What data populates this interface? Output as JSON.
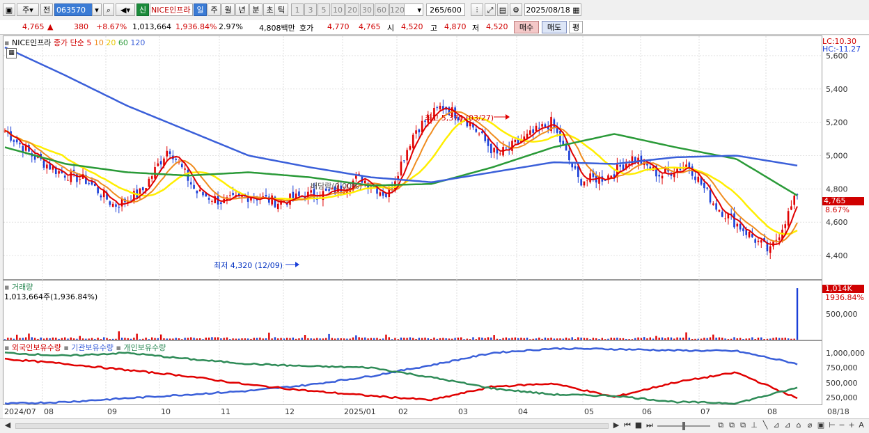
{
  "toolbar": {
    "market_label": "주",
    "prev_label": "전",
    "code_value": "063570",
    "signal_label": "신",
    "stock_name": "NICE인프라",
    "period_tabs": [
      "일",
      "주",
      "월",
      "년",
      "분",
      "초",
      "틱"
    ],
    "period_active": "일",
    "minute_options": [
      "1",
      "3",
      "5",
      "10",
      "20",
      "30",
      "60",
      "120"
    ],
    "count_value": "265",
    "count_max": "/600",
    "date_value": "2025/08/18"
  },
  "quote": {
    "price": "4,765",
    "arrow": "▲",
    "change": "380",
    "change_pct": "+8.67%",
    "volume": "1,013,664",
    "volume_ratio": "1,936.84%",
    "turnover_pct": "2.97%",
    "amount": "4,808백만",
    "hoga_label": "호가",
    "ask": "4,770",
    "bid": "4,765",
    "open_label": "시",
    "open": "4,520",
    "high_label": "고",
    "high": "4,870",
    "low_label": "저",
    "low": "4,520",
    "buy_label": "매수",
    "sell_label": "매도",
    "eval_label": "평"
  },
  "price_panel": {
    "legend_name": "NICE인프라",
    "legend_type": "종가 단순",
    "ma_labels": [
      "5",
      "10",
      "20",
      "60",
      "120"
    ],
    "lc": "LC:10.30",
    "hc": "HC:-11.27",
    "high_annotation": "최고 5,370 (03/27)",
    "low_annotation": "최저 4,320 (12/09)",
    "dividend_annotation": "배당락(0.00%)",
    "last_price_label": "4,765",
    "last_pct_label": "8.67%",
    "y_ticks": [
      "5,600",
      "5,400",
      "5,200",
      "5,000",
      "4,800",
      "4,600",
      "4,400"
    ]
  },
  "volume_panel": {
    "title": "거래량",
    "summary": "1,013,664주(1,936.84%)",
    "last_label": "1,014K",
    "last_pct": "1936.84%",
    "y_ticks": [
      "500,000"
    ]
  },
  "holding_panel": {
    "legend": [
      "외국인보유수량",
      "기관보유수량",
      "개인보유수량"
    ],
    "y_ticks": [
      "1,000,000",
      "750,000",
      "500,000",
      "250,000"
    ]
  },
  "x_ticks": [
    "2024/07",
    "08",
    "09",
    "10",
    "11",
    "12",
    "2025/01",
    "02",
    "03",
    "04",
    "05",
    "06",
    "07",
    "08",
    "08/18"
  ],
  "colors": {
    "candle_up": "#e00000",
    "candle_down": "#1a3fd8",
    "ma5": "#e00000",
    "ma10": "#f08c1e",
    "ma20": "#ffee00",
    "ma60": "#2a9a38",
    "ma120": "#3a5fd9",
    "foreign": "#3a5fd9",
    "institution": "#e00000",
    "individual": "#2e8b57"
  },
  "chart_data": {
    "type": "candlestick",
    "title": "NICE인프라",
    "x_range": [
      "2024/07",
      "2025/08/18"
    ],
    "price_ylim": [
      4300,
      5700
    ],
    "key_points": [
      {
        "label": "최고",
        "value": 5370,
        "date": "03/27"
      },
      {
        "label": "최저",
        "value": 4320,
        "date": "12/09"
      },
      {
        "label": "last close",
        "value": 4765,
        "date": "08/18"
      }
    ],
    "ma120_approx": [
      5650,
      5480,
      5300,
      5150,
      5000,
      4930,
      4870,
      4840,
      4900,
      4960,
      4950,
      4990,
      5000,
      4940
    ],
    "ma60_approx": [
      5050,
      4950,
      4900,
      4880,
      4900,
      4870,
      4820,
      4830,
      4930,
      5050,
      5130,
      5050,
      4980,
      4760
    ],
    "volume_last": 1013664,
    "holdings_series": [
      {
        "name": "외국인보유수량",
        "approx": [
          170000,
          200000,
          260000,
          320000,
          380000,
          480000,
          620000,
          800000,
          1000000,
          1070000,
          1060000,
          1040000,
          1030000,
          820000
        ]
      },
      {
        "name": "기관보유수량",
        "approx": [
          900000,
          820000,
          720000,
          620000,
          480000,
          380000,
          300000,
          230000,
          450000,
          500000,
          280000,
          520000,
          680000,
          260000
        ]
      },
      {
        "name": "개인보유수량",
        "approx": [
          1000000,
          950000,
          1000000,
          900000,
          820000,
          780000,
          760000,
          600000,
          420000,
          320000,
          300000,
          200000,
          180000,
          430000
        ]
      }
    ]
  }
}
